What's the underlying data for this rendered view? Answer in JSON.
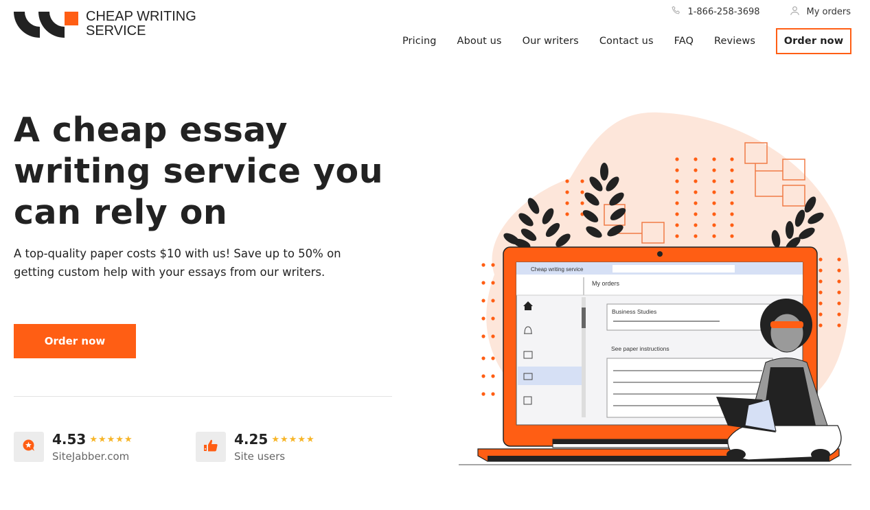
{
  "brand": {
    "name_line1": "CHEAP WRITING",
    "name_line2": "SERVICE",
    "accent_color": "#ff5e14",
    "dark_color": "#222222"
  },
  "topbar": {
    "phone": "1-866-258-3698",
    "phone_icon": "phone-icon",
    "my_orders": "My orders",
    "user_icon": "user-icon"
  },
  "nav": {
    "items": [
      {
        "label": "Pricing"
      },
      {
        "label": "About us"
      },
      {
        "label": "Our writers"
      },
      {
        "label": "Contact us"
      },
      {
        "label": "FAQ"
      },
      {
        "label": "Reviews"
      }
    ],
    "order_button": "Order now"
  },
  "hero": {
    "title": "A cheap essay writing service you can rely on",
    "subtitle": "A top-quality paper costs $10 with us! Save up to 50% on getting custom help with your essays from our writers.",
    "cta": "Order now"
  },
  "ratings": [
    {
      "score": "4.53",
      "source": "SiteJabber.com",
      "stars": 5,
      "icon": "sitejabber-icon"
    },
    {
      "score": "4.25",
      "source": "Site users",
      "stars": 5,
      "icon": "thumbs-up-icon"
    }
  ],
  "illustration": {
    "app_title": "Cheap writing service",
    "page_title": "My orders",
    "order_subject": "Business Studies",
    "instructions_label": "See paper instructions"
  }
}
